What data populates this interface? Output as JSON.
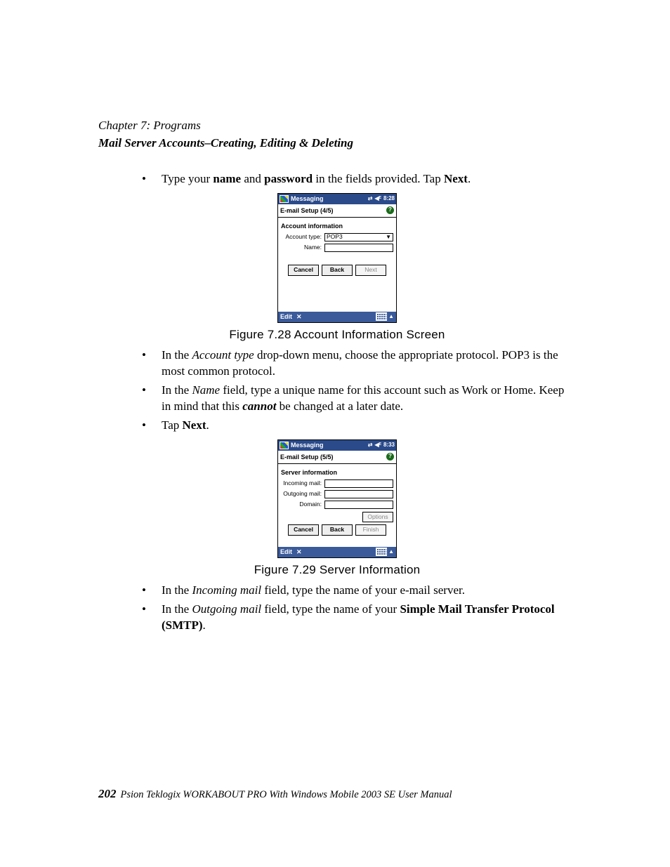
{
  "header": {
    "chapter": "Chapter 7:  Programs",
    "section": "Mail Server Accounts–Creating, Editing & Deleting"
  },
  "bullets": {
    "b1_pre": "Type your ",
    "b1_bold1": "name",
    "b1_mid": " and ",
    "b1_bold2": "password",
    "b1_mid2": " in the fields provided. Tap ",
    "b1_bold3": "Next",
    "b1_end": ".",
    "b2_pre": "In the ",
    "b2_ital": "Account type",
    "b2_rest": " drop-down menu, choose the appropriate protocol. POP3 is the most common protocol.",
    "b3_pre": "In the ",
    "b3_ital": "Name",
    "b3_mid": " field, type a unique name for this account such as Work or Home. Keep in mind that this ",
    "b3_boldital": "cannot",
    "b3_end": " be changed at a later date.",
    "b4_pre": "Tap ",
    "b4_bold": "Next",
    "b4_end": ".",
    "b5_pre": "In the ",
    "b5_ital": "Incoming mail",
    "b5_rest": " field, type the name of your e-mail server.",
    "b6_pre": "In the ",
    "b6_ital": "Outgoing mail",
    "b6_mid": " field, type the name of your ",
    "b6_bold": "Simple Mail Transfer Protocol (SMTP)",
    "b6_end": "."
  },
  "figure1": {
    "caption": "Figure 7.28 Account Information Screen",
    "titlebar": "Messaging",
    "time": "8:28",
    "sub": "E-mail Setup (4/5)",
    "section": "Account information",
    "label_type": "Account type:",
    "value_type": "POP3",
    "label_name": "Name:",
    "btn_cancel": "Cancel",
    "btn_back": "Back",
    "btn_next": "Next",
    "edit": "Edit",
    "x": "✕"
  },
  "figure2": {
    "caption": "Figure 7.29 Server Information",
    "titlebar": "Messaging",
    "time": "8:33",
    "sub": "E-mail Setup (5/5)",
    "section": "Server information",
    "label_in": "Incoming mail:",
    "label_out": "Outgoing mail:",
    "label_dom": "Domain:",
    "btn_options": "Options",
    "btn_cancel": "Cancel",
    "btn_back": "Back",
    "btn_finish": "Finish",
    "edit": "Edit",
    "x": "✕"
  },
  "footer": {
    "page": "202",
    "text": "Psion Teklogix WORKABOUT PRO With Windows Mobile 2003 SE User Manual"
  }
}
